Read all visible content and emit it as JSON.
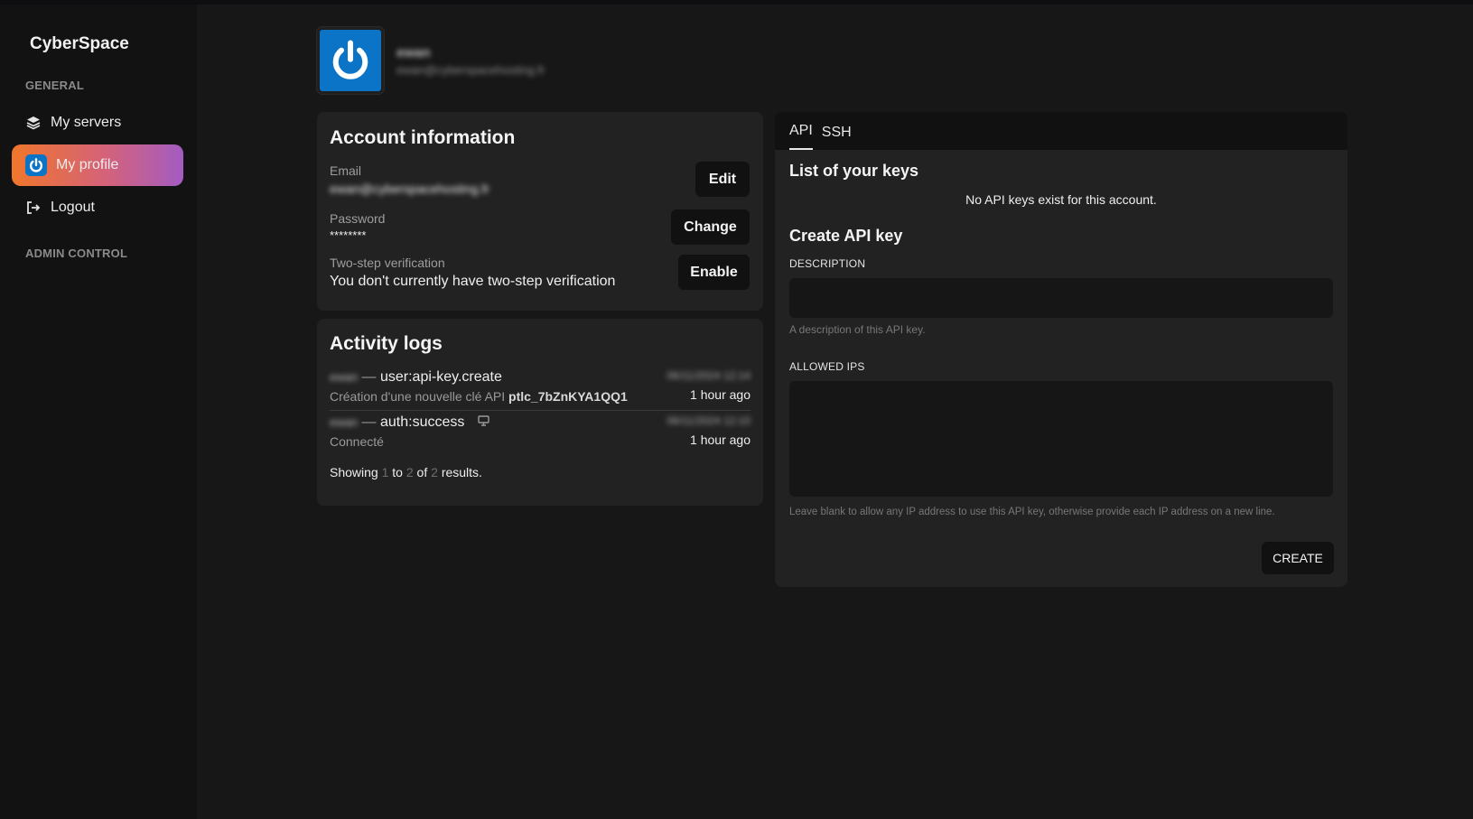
{
  "app": {
    "brand": "CyberSpace"
  },
  "sidebar": {
    "general_label": "GENERAL",
    "admin_label": "ADMIN CONTROL",
    "items": [
      {
        "label": "My servers",
        "icon": "layers-icon"
      },
      {
        "label": "My profile",
        "icon": "power-avatar-icon"
      },
      {
        "label": "Logout",
        "icon": "logout-icon"
      }
    ]
  },
  "profile": {
    "name": "ewan",
    "email": "ewan@cyberspacehosting.fr"
  },
  "account": {
    "title": "Account information",
    "email_label": "Email",
    "email_value": "ewan@cyberspacehosting.fr",
    "edit_label": "Edit",
    "password_label": "Password",
    "password_value": "********",
    "change_label": "Change",
    "twofa_label": "Two-step verification",
    "twofa_value": "You don't currently have two-step verification",
    "enable_label": "Enable"
  },
  "activity": {
    "title": "Activity logs",
    "rows": [
      {
        "user": "ewan",
        "event": "user:api-key.create",
        "description": "Création d'une nouvelle clé API",
        "key": "ptlc_7bZnKYA1QQ1",
        "date": "06/11/2024 12:14",
        "ago": "1 hour ago"
      },
      {
        "user": "ewan",
        "event": "auth:success",
        "description": "Connecté",
        "date": "06/11/2024 12:10",
        "ago": "1 hour ago"
      }
    ],
    "showing": {
      "prefix": "Showing",
      "from": "1",
      "to_word": "to",
      "to": "2",
      "of_word": "of",
      "total": "2",
      "suffix": "results."
    }
  },
  "keys": {
    "tabs": [
      "API",
      "SSH"
    ],
    "list_title": "List of your keys",
    "empty_text": "No API keys exist for this account.",
    "create_title": "Create API key",
    "description_label": "DESCRIPTION",
    "description_value": "",
    "description_hint": "A description of this API key.",
    "ips_label": "ALLOWED IPS",
    "ips_value": "",
    "ips_hint": "Leave blank to allow any IP address to use this API key, otherwise provide each IP address on a new line.",
    "create_button": "CREATE"
  },
  "colors": {
    "accent_start": "#f0762b",
    "accent_end": "#a35cc2",
    "avatar_blue": "#0b74c7"
  }
}
